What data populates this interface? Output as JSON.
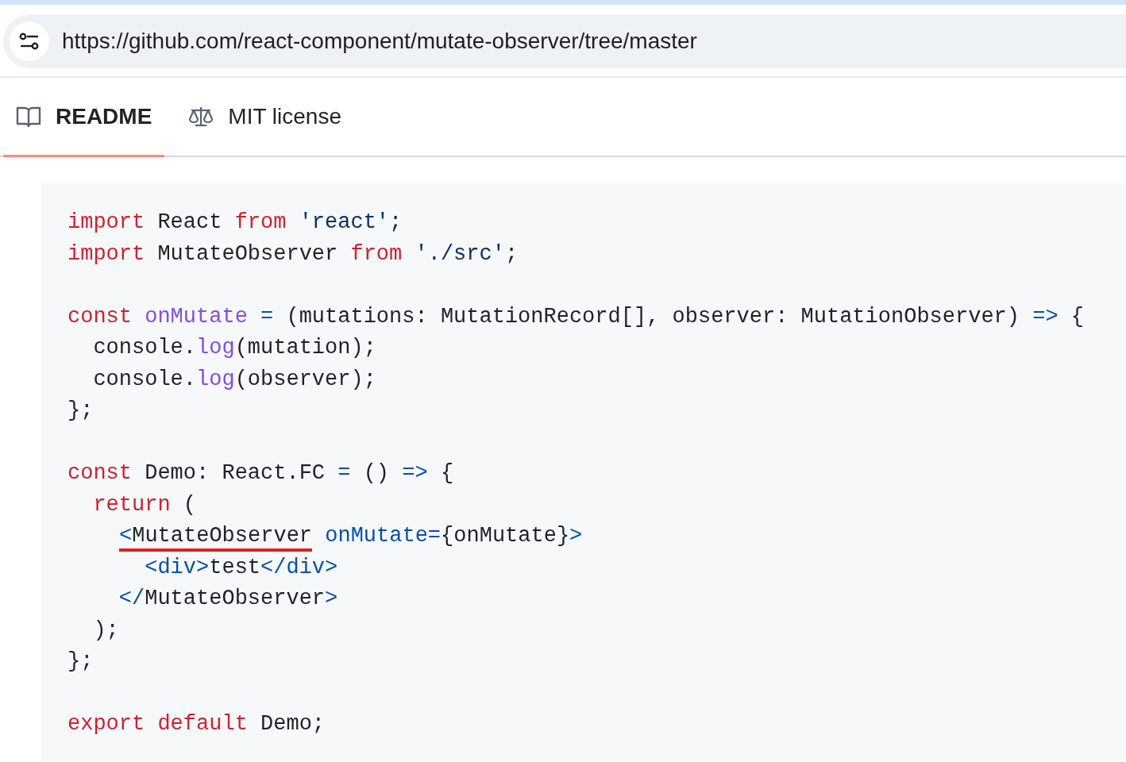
{
  "address_bar": {
    "url": "https://github.com/react-component/mutate-observer/tree/master"
  },
  "tabs": [
    {
      "label": "README",
      "selected": true
    },
    {
      "label": "MIT license",
      "selected": false
    }
  ],
  "code_blocks": [
    [
      [
        {
          "kind": "keyword",
          "text": "import"
        },
        {
          "kind": "plain",
          "text": " React "
        },
        {
          "kind": "keyword",
          "text": "from"
        },
        {
          "kind": "string",
          "text": " 'react'"
        },
        {
          "kind": "plain",
          "text": ";"
        }
      ],
      [
        {
          "kind": "keyword",
          "text": "import"
        },
        {
          "kind": "plain",
          "text": " MutateObserver "
        },
        {
          "kind": "keyword",
          "text": "from"
        },
        {
          "kind": "string",
          "text": " './src'"
        },
        {
          "kind": "plain",
          "text": ";"
        }
      ]
    ],
    [
      [
        {
          "kind": "keyword",
          "text": "const"
        },
        {
          "kind": "entity",
          "text": " onMutate"
        },
        {
          "kind": "constant",
          "text": " ="
        },
        {
          "kind": "plain",
          "text": " (mutations: MutationRecord[], observer: MutationObserver) "
        },
        {
          "kind": "constant",
          "text": "=>"
        },
        {
          "kind": "plain",
          "text": " {"
        }
      ],
      [
        {
          "kind": "plain",
          "text": "  console."
        },
        {
          "kind": "entity",
          "text": "log"
        },
        {
          "kind": "plain",
          "text": "(mutation);"
        }
      ],
      [
        {
          "kind": "plain",
          "text": "  console."
        },
        {
          "kind": "entity",
          "text": "log"
        },
        {
          "kind": "plain",
          "text": "(observer);"
        }
      ],
      [
        {
          "kind": "plain",
          "text": "};"
        }
      ]
    ],
    [
      [
        {
          "kind": "keyword",
          "text": "const"
        },
        {
          "kind": "plain",
          "text": " Demo: React.FC "
        },
        {
          "kind": "constant",
          "text": "="
        },
        {
          "kind": "plain",
          "text": " () "
        },
        {
          "kind": "constant",
          "text": "=>"
        },
        {
          "kind": "plain",
          "text": " {"
        }
      ],
      [
        {
          "kind": "keyword",
          "text": "  return"
        },
        {
          "kind": "plain",
          "text": " ("
        }
      ],
      [
        {
          "kind": "marked",
          "parts": [
            {
              "kind": "constant",
              "text": "<"
            },
            {
              "kind": "plain",
              "text": "MutateObserver"
            }
          ]
        },
        {
          "kind": "constant",
          "text": " onMutate="
        },
        {
          "kind": "plain",
          "text": "{onMutate}"
        },
        {
          "kind": "constant",
          "text": ">"
        }
      ],
      [
        {
          "kind": "constant",
          "text": "      <div>"
        },
        {
          "kind": "plain",
          "text": "test"
        },
        {
          "kind": "constant",
          "text": "</div>"
        }
      ],
      [
        {
          "kind": "constant",
          "text": "    </"
        },
        {
          "kind": "plain",
          "text": "MutateObserver"
        },
        {
          "kind": "constant",
          "text": ">"
        }
      ],
      [
        {
          "kind": "plain",
          "text": "  );"
        }
      ],
      [
        {
          "kind": "plain",
          "text": "};"
        }
      ]
    ],
    [
      [
        {
          "kind": "keyword",
          "text": "export"
        },
        {
          "kind": "keyword",
          "text": " default"
        },
        {
          "kind": "plain",
          "text": " Demo;"
        }
      ]
    ]
  ]
}
